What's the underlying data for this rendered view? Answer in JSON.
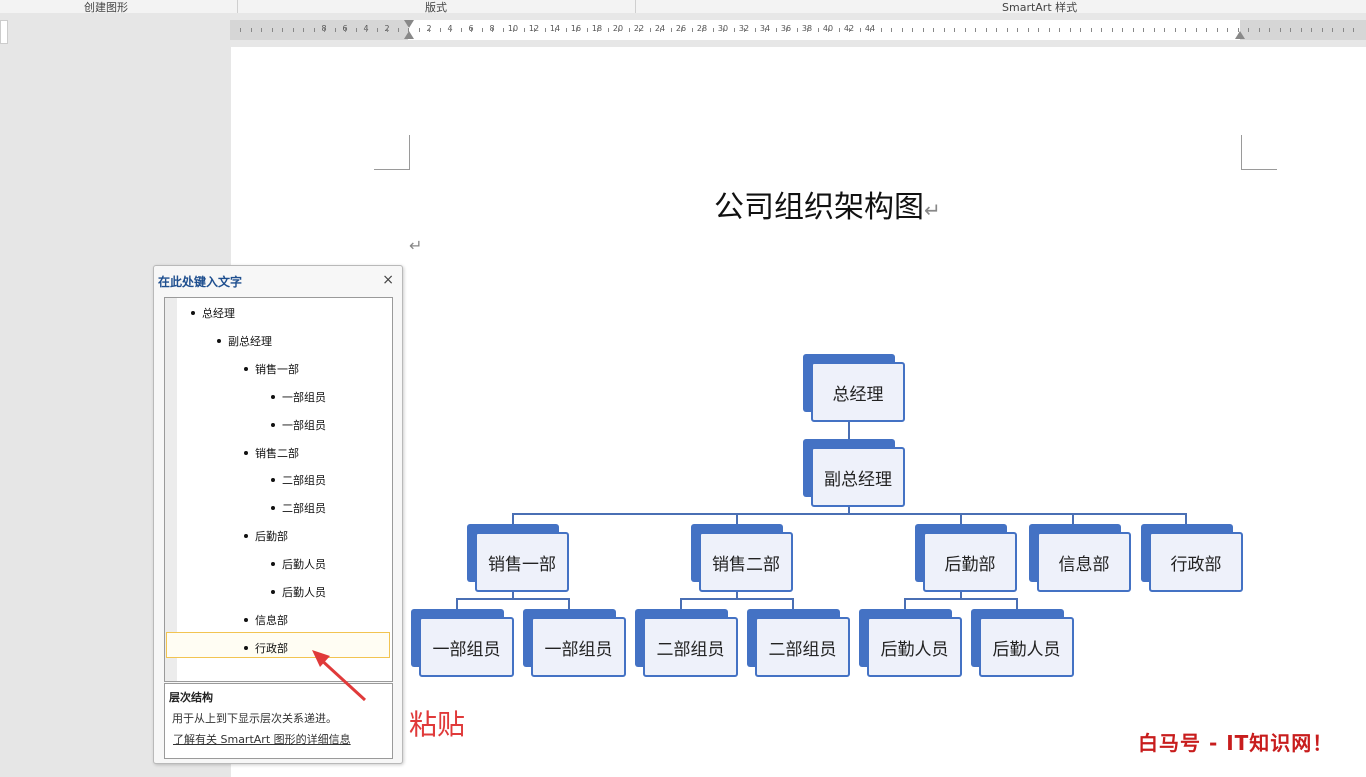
{
  "ribbon": {
    "group1": "创建图形",
    "group2": "版式",
    "group3": "SmartArt 样式"
  },
  "ruler": {
    "left_numbers": [
      "8",
      "6",
      "4",
      "2"
    ],
    "right_numbers": [
      "2",
      "4",
      "6",
      "8",
      "10",
      "12",
      "14",
      "16",
      "18",
      "20",
      "22",
      "24",
      "26",
      "28",
      "30",
      "32",
      "34",
      "36",
      "38",
      "40",
      "42",
      "44"
    ]
  },
  "document": {
    "title": "公司组织架构图",
    "para_mark": "↵"
  },
  "org_chart": {
    "root": "总经理",
    "level2": "副总经理",
    "departments": [
      "销售一部",
      "销售二部",
      "后勤部",
      "信息部",
      "行政部"
    ],
    "members": [
      "一部组员",
      "一部组员",
      "二部组员",
      "二部组员",
      "后勤人员",
      "后勤人员"
    ]
  },
  "text_pane": {
    "title": "在此处键入文字",
    "close": "×",
    "items": [
      {
        "level": 1,
        "text": "总经理"
      },
      {
        "level": 2,
        "text": "副总经理"
      },
      {
        "level": 3,
        "text": "销售一部"
      },
      {
        "level": 4,
        "text": "一部组员"
      },
      {
        "level": 4,
        "text": "一部组员"
      },
      {
        "level": 3,
        "text": "销售二部"
      },
      {
        "level": 4,
        "text": "二部组员"
      },
      {
        "level": 4,
        "text": "二部组员"
      },
      {
        "level": 3,
        "text": "后勤部"
      },
      {
        "level": 4,
        "text": "后勤人员"
      },
      {
        "level": 4,
        "text": "后勤人员"
      },
      {
        "level": 3,
        "text": "信息部"
      },
      {
        "level": 3,
        "text": "行政部"
      }
    ],
    "desc_heading": "层次结构",
    "desc_text": "用于从上到下显示层次关系递进。",
    "desc_link": "了解有关 SmartArt 图形的详细信息"
  },
  "annotation": "粘贴",
  "watermark": "白马号 - IT知识网！",
  "colors": {
    "accent": "#4472c4",
    "annotation": "#e03a3a"
  }
}
